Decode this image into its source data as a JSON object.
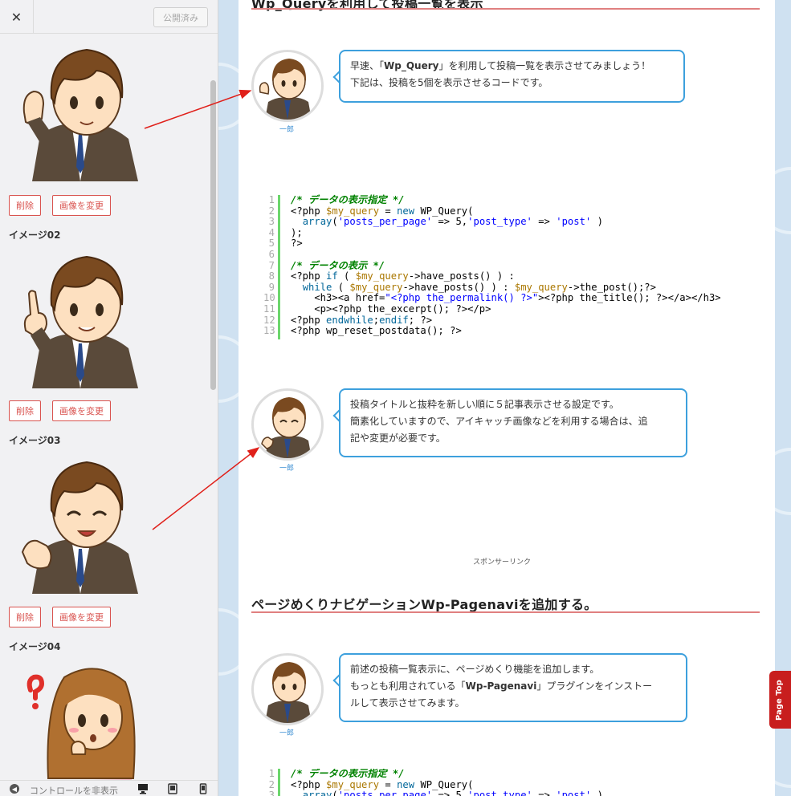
{
  "panel": {
    "close_glyph": "✕",
    "publish_label": "公開済み",
    "images": [
      {
        "label": "",
        "delete_label": "削除",
        "change_label": "画像を変更"
      },
      {
        "label": "イメージ02",
        "delete_label": "削除",
        "change_label": "画像を変更"
      },
      {
        "label": "イメージ03",
        "delete_label": "削除",
        "change_label": "画像を変更"
      },
      {
        "label": "イメージ04"
      }
    ],
    "footer": {
      "collapse_glyph": "◀",
      "collapse_label": "コントロールを非表示",
      "device_icons": [
        "desktop-icon",
        "tablet-icon",
        "mobile-icon"
      ]
    }
  },
  "content": {
    "section1_title": "Wp_Queryを利用して投稿一覧を表示",
    "balloon1": {
      "name": "一郎",
      "line1_pre": "早速、「",
      "line1_bold": "Wp_Query",
      "line1_post": "」を利用して投稿一覧を表示させてみましょう！",
      "line2": "下記は、投稿を5個を表示させるコードです。"
    },
    "code1_gutter": "1\n2\n3\n4\n5\n6\n7\n8\n9\n10\n11\n12\n13",
    "balloon2": {
      "name": "一郎",
      "line1": "投稿タイトルと抜粋を新しい順に５記事表示させる設定です。",
      "line2": "簡素化していますので、アイキャッチ画像などを利用する場合は、追",
      "line3": "記や変更が必要です。"
    },
    "sponsor": "スポンサーリンク",
    "section2_title": "ページめくりナビゲーションWp-Pagenaviを追加する。",
    "balloon3": {
      "name": "一郎",
      "line1": "前述の投稿一覧表示に、ページめくり機能を追加します。",
      "line2_pre": "もっとも利用されている「",
      "line2_bold": "Wp-Pagenavi",
      "line2_post": "」プラグインをインストー",
      "line3": "ルして表示させてみます。"
    },
    "code2_gutter": "1\n2\n3",
    "page_top": "Page Top"
  },
  "colors": {
    "accent_blue": "#3da0dd",
    "heading_line": "#e08080",
    "delete_red": "#d9534f",
    "page_top_red": "#c81e1e",
    "bg_blue": "#cfe1f1"
  }
}
